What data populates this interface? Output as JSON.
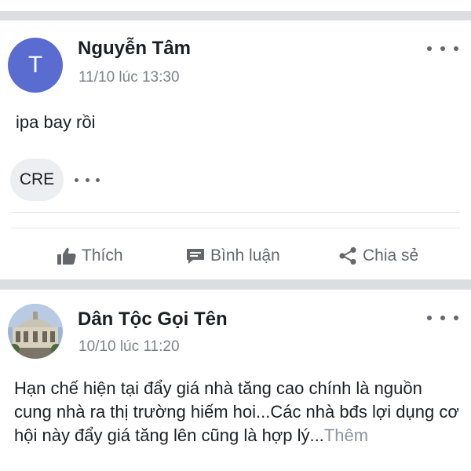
{
  "post1": {
    "avatar_letter": "T",
    "author": "Nguyễn Tâm",
    "timestamp": "11/10 lúc 13:30",
    "text": "ipa bay rồi",
    "chip_label": "CRE",
    "actions": {
      "like": "Thích",
      "comment": "Bình luận",
      "share": "Chia sẻ"
    }
  },
  "post2": {
    "author": "Dân Tộc Gọi Tên",
    "timestamp": "10/10 lúc 11:20",
    "text": "Hạn chế hiện tại đẩy giá nhà tăng cao chính là nguồn cung nhà ra thị trường hiếm hoi...Các nhà bđs lợi dụng cơ hội này đẩy giá tăng lên cũng là hợp lý...",
    "see_more": "Thêm"
  },
  "colors": {
    "avatar_bg": "#5b6cd1",
    "separator": "#dcdde1",
    "secondary_text": "#7f8287",
    "action_gray": "#65676b"
  },
  "icons": [
    "more-icon",
    "like-icon",
    "comment-icon",
    "share-icon"
  ]
}
